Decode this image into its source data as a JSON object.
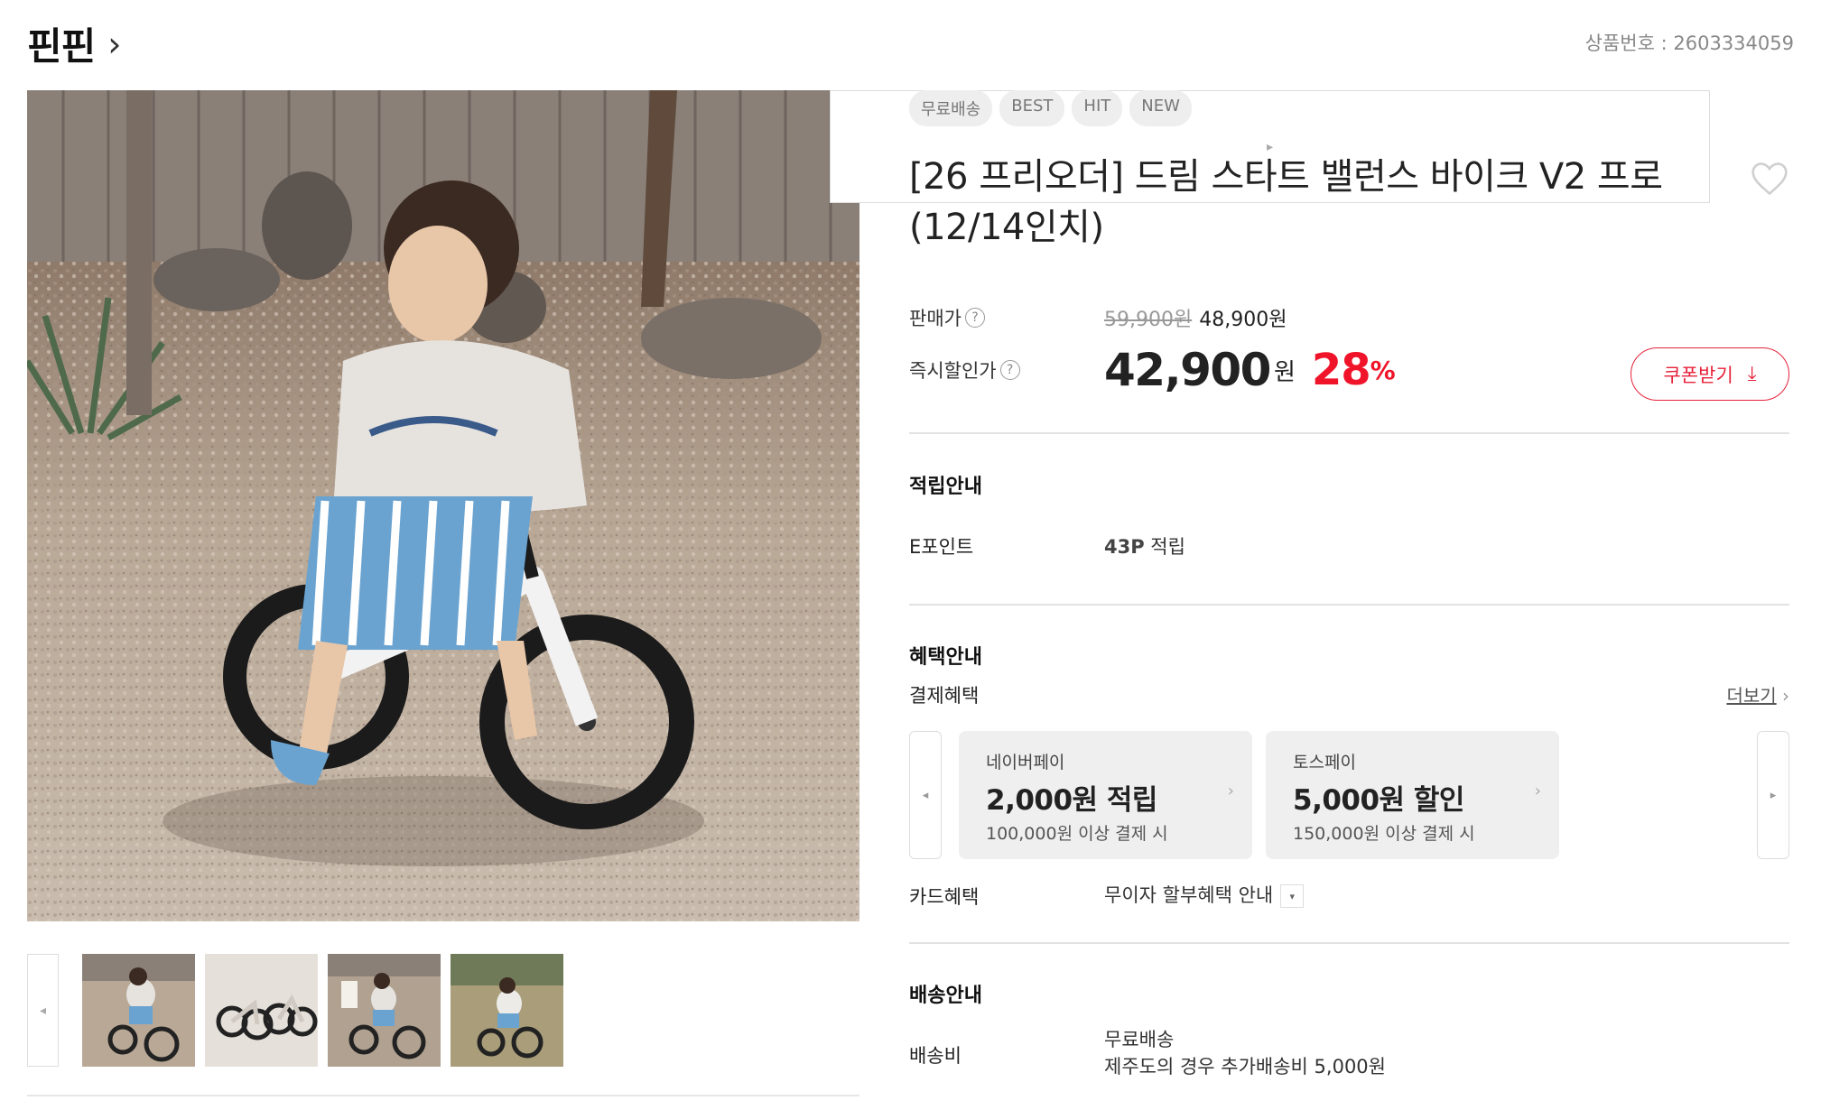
{
  "header": {
    "brand": "핀핀",
    "brand_chevron": "›",
    "product_number": "상품번호 : 2603334059"
  },
  "gallery": {
    "prev_icon": "◂",
    "next_icon": "▸",
    "thumbnails": [
      "thumb-1",
      "thumb-2",
      "thumb-3",
      "thumb-4"
    ]
  },
  "product": {
    "badges": [
      "무료배송",
      "BEST",
      "HIT",
      "NEW"
    ],
    "title": "[26 프리오더] 드림 스타트 밸런스 바이크 V2 프로 (12/14인치)",
    "wishlist_icon": "heart-outline-icon"
  },
  "price": {
    "sale_label": "판매가",
    "help_icon": "?",
    "original": "59,900원",
    "sale": "48,900원",
    "instant_label": "즉시할인가",
    "instant_price": "42,900",
    "won": "원",
    "discount_rate": "28",
    "percent": "%",
    "coupon_button": "쿠폰받기",
    "coupon_icon": "⤓"
  },
  "points": {
    "title": "적립안내",
    "label": "E포인트",
    "value_bold": "43P",
    "value_rest": " 적립"
  },
  "benefits": {
    "title": "혜택안내",
    "payment_label": "결제혜택",
    "more": "더보기",
    "more_icon": "›",
    "cards": [
      {
        "name": "네이버페이",
        "amount": "2,000원 적립",
        "condition": "100,000원 이상 결제 시"
      },
      {
        "name": "토스페이",
        "amount": "5,000원 할인",
        "condition": "150,000원 이상 결제 시"
      }
    ],
    "card_chevron": "›",
    "card_label": "카드혜택",
    "card_value": "무이자 할부혜택 안내",
    "dropdown_icon": "▾"
  },
  "shipping": {
    "title": "배송안내",
    "label": "배송비",
    "line1": "무료배송",
    "line2": "제주도의 경우 추가배송비 5,000원"
  },
  "colors": {
    "accent_red": "#f0142a",
    "badge_bg": "#eeeeee",
    "card_bg": "#efefef"
  }
}
